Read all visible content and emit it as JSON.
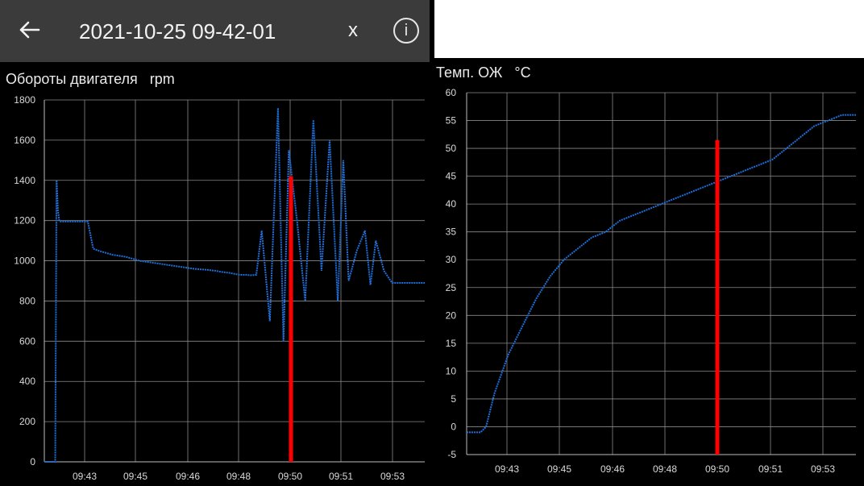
{
  "header": {
    "title": "2021-10-25 09-42-01",
    "close_label": "x",
    "info_label": "i",
    "back_icon": "arrow-left-icon",
    "info_icon": "info-icon"
  },
  "colors": {
    "series": "#1e6fd9",
    "marker": "#ff0000",
    "grid": "#8a8a8a",
    "header_bg": "#3b3b3b"
  },
  "chart_data": [
    {
      "type": "line",
      "title": "Обороты двигателя",
      "unit": "rpm",
      "ylim": [
        0,
        1800
      ],
      "yticks": [
        "0",
        "200",
        "400",
        "600",
        "800",
        "1000",
        "1200",
        "1400",
        "1600",
        "1800"
      ],
      "xticks": [
        "09:43",
        "09:45",
        "09:46",
        "09:48",
        "09:50",
        "09:51",
        "09:53"
      ],
      "grid": true,
      "marker_value": 1420,
      "series": [
        {
          "x": [
            0,
            0.2,
            0.4,
            0.45,
            0.5,
            0.55,
            0.6,
            0.8,
            1.0,
            1.2,
            1.4,
            1.6,
            1.8,
            2.0,
            2.5,
            3.0,
            3.5,
            4.0,
            4.5,
            5.0,
            5.5,
            6.0,
            6.3,
            6.5,
            6.8,
            7.0,
            7.2,
            7.4,
            7.6,
            7.8,
            8.0,
            8.3,
            8.6,
            8.8,
            9.0,
            9.3,
            9.6,
            9.9,
            10.2,
            10.5,
            10.8,
            11.0,
            11.2,
            11.5,
            11.8,
            12.0,
            12.2,
            12.5,
            12.8,
            13.0,
            13.3,
            13.6,
            14.0
          ],
          "values": [
            0,
            0,
            0,
            1400,
            1250,
            1200,
            1195,
            1195,
            1195,
            1195,
            1195,
            1195,
            1060,
            1050,
            1030,
            1020,
            1000,
            990,
            980,
            970,
            960,
            955,
            950,
            945,
            940,
            935,
            930,
            930,
            928,
            930,
            1150,
            700,
            1760,
            600,
            1550,
            1200,
            800,
            1700,
            950,
            1600,
            800,
            1500,
            900,
            1050,
            1150,
            880,
            1100,
            950,
            890,
            890,
            890,
            890,
            890
          ]
        }
      ]
    },
    {
      "type": "line",
      "title": "Темп. ОЖ",
      "unit": "°C",
      "ylim": [
        -5,
        60
      ],
      "yticks": [
        "-5",
        "0",
        "5",
        "10",
        "15",
        "20",
        "25",
        "30",
        "35",
        "40",
        "45",
        "50",
        "55",
        "60"
      ],
      "xticks": [
        "09:43",
        "09:45",
        "09:46",
        "09:48",
        "09:50",
        "09:51",
        "09:53"
      ],
      "grid": true,
      "marker_value": 51.5,
      "series": [
        {
          "x": [
            0,
            0.5,
            0.7,
            1.0,
            1.5,
            2.0,
            2.5,
            3.0,
            3.5,
            4.0,
            4.5,
            5.0,
            5.5,
            6.0,
            6.5,
            7.0,
            7.5,
            8.0,
            8.5,
            9.0,
            9.5,
            10.0,
            10.5,
            11.0,
            11.5,
            12.0,
            12.5,
            13.0,
            13.5,
            14.0
          ],
          "values": [
            -1,
            -1,
            0,
            6,
            13,
            18,
            23,
            27,
            30,
            32,
            34,
            35,
            37,
            38,
            39,
            40,
            41,
            42,
            43,
            44,
            45,
            46,
            47,
            48,
            50,
            52,
            54,
            55,
            56,
            56
          ]
        }
      ]
    }
  ]
}
